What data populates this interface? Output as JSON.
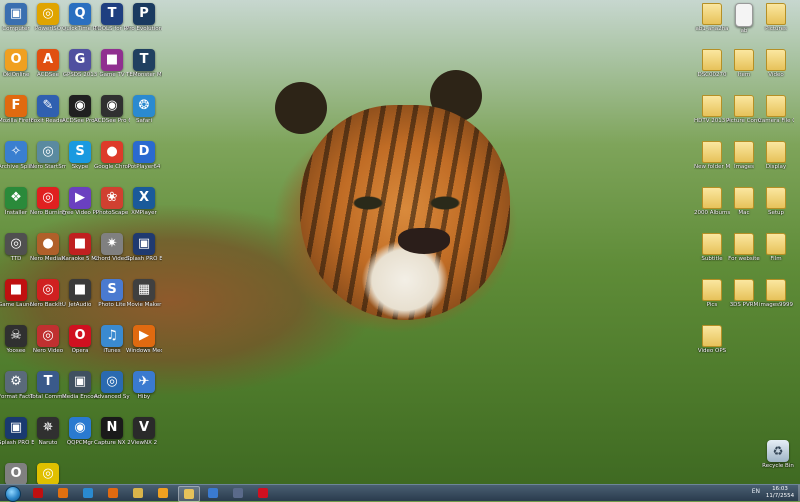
{
  "left_icons": [
    {
      "label": "Computer",
      "glyph": "▣",
      "color": "#3a6fb0",
      "icon": "computer-icon"
    },
    {
      "label": "PowerISO",
      "glyph": "◎",
      "color": "#e0a400",
      "icon": "disc-icon"
    },
    {
      "label": "QuickTime Player",
      "glyph": "Q",
      "color": "#2a6fc0",
      "icon": "quicktime-icon"
    },
    {
      "label": "TOOLS for PPSSPP",
      "glyph": "T",
      "color": "#1f3f80",
      "icon": "tools-icon"
    },
    {
      "label": "Pro Evolution Soccer 2013",
      "glyph": "P",
      "color": "#1a3a60",
      "icon": "game-icon"
    },
    {
      "label": "OkiOnline",
      "glyph": "O",
      "color": "#f0a020",
      "icon": "basketball-icon"
    },
    {
      "label": "ACDSee",
      "glyph": "A",
      "color": "#e05010",
      "icon": "acdsee-icon"
    },
    {
      "label": "GPSDS 2013",
      "glyph": "G",
      "color": "#5050a0",
      "icon": "gps-icon"
    },
    {
      "label": "Game TV",
      "glyph": "■",
      "color": "#903090",
      "icon": "tv-icon"
    },
    {
      "label": "TEMonster Media",
      "glyph": "T",
      "color": "#204060",
      "icon": "media-icon"
    },
    {
      "label": "Mozilla Firefox",
      "glyph": "F",
      "color": "#e06a10",
      "icon": "firefox-icon"
    },
    {
      "label": "Foxit Reader",
      "glyph": "✎",
      "color": "#3060b0",
      "icon": "foxit-icon"
    },
    {
      "label": "ACDSee Pro 6",
      "glyph": "◉",
      "color": "#202020",
      "icon": "camera-icon"
    },
    {
      "label": "ACDSee Pro 6",
      "glyph": "◉",
      "color": "#303030",
      "icon": "camera-icon"
    },
    {
      "label": "Safari",
      "glyph": "❂",
      "color": "#2a8ad0",
      "icon": "safari-icon"
    },
    {
      "label": "Archive Splitter",
      "glyph": "✧",
      "color": "#3a7fd0",
      "icon": "splitter-icon"
    },
    {
      "label": "Nero StartSmart",
      "glyph": "◎",
      "color": "#5a8aa0",
      "icon": "search-disc-icon"
    },
    {
      "label": "Skype",
      "glyph": "S",
      "color": "#1a9ae0",
      "icon": "skype-icon"
    },
    {
      "label": "Google Chrome",
      "glyph": "●",
      "color": "#dd3a2a",
      "icon": "chrome-icon"
    },
    {
      "label": "PotPlayer64",
      "glyph": "D",
      "color": "#2a6ad0",
      "icon": "player-icon"
    },
    {
      "label": "Installer",
      "glyph": "❖",
      "color": "#2a8a3a",
      "icon": "installer-icon"
    },
    {
      "label": "Nero Burning ROM",
      "glyph": "◎",
      "color": "#e02020",
      "icon": "nero-icon"
    },
    {
      "label": "Free Video Player",
      "glyph": "▶",
      "color": "#6a40c0",
      "icon": "video-player-icon"
    },
    {
      "label": "PhotoScape",
      "glyph": "❀",
      "color": "#d04030",
      "icon": "photoscape-icon"
    },
    {
      "label": "XMPlayer",
      "glyph": "X",
      "color": "#1a5a9a",
      "icon": "xmplayer-icon"
    },
    {
      "label": "TTD",
      "glyph": "◎",
      "color": "#505050",
      "icon": "wheel-icon"
    },
    {
      "label": "Nero MediaHome",
      "glyph": "●",
      "color": "#b0602a",
      "icon": "mediahome-icon"
    },
    {
      "label": "Karaoke 5 Movie Maker",
      "glyph": "■",
      "color": "#c02020",
      "icon": "karaoke-icon"
    },
    {
      "label": "Chord VideoStudio",
      "glyph": "✷",
      "color": "#808080",
      "icon": "videostudio-icon"
    },
    {
      "label": "Splash PRO EX",
      "glyph": "▣",
      "color": "#203a70",
      "icon": "splash-icon"
    },
    {
      "label": "Game Launcher",
      "glyph": "■",
      "color": "#c01010",
      "icon": "game-launcher-icon"
    },
    {
      "label": "Nero BackItUp",
      "glyph": "◎",
      "color": "#d02020",
      "icon": "backup-icon"
    },
    {
      "label": "JetAudio",
      "glyph": "■",
      "color": "#3a3a3a",
      "icon": "jetaudio-icon"
    },
    {
      "label": "Photo Lite",
      "glyph": "S",
      "color": "#4a7ad0",
      "icon": "photo-icon"
    },
    {
      "label": "Movie Maker",
      "glyph": "▦",
      "color": "#404040",
      "icon": "moviemaker-icon"
    },
    {
      "label": "Yoosee",
      "glyph": "☠",
      "color": "#303030",
      "icon": "yoosee-icon"
    },
    {
      "label": "Nero Video",
      "glyph": "◎",
      "color": "#c03030",
      "icon": "nero-video-icon"
    },
    {
      "label": "Opera",
      "glyph": "O",
      "color": "#d01020",
      "icon": "opera-icon"
    },
    {
      "label": "iTunes",
      "glyph": "♫",
      "color": "#3a8ad0",
      "icon": "itunes-icon"
    },
    {
      "label": "Windows Media Player",
      "glyph": "▶",
      "color": "#e06a10",
      "icon": "wmp-icon"
    },
    {
      "label": "Format Factory",
      "glyph": "⚙",
      "color": "#5a6a7a",
      "icon": "format-factory-icon"
    },
    {
      "label": "Total Commander",
      "glyph": "T",
      "color": "#3a5a8a",
      "icon": "commander-icon"
    },
    {
      "label": "Media Encoder",
      "glyph": "▣",
      "color": "#405060",
      "icon": "encoder-icon"
    },
    {
      "label": "Advanced SystemCare",
      "glyph": "◎",
      "color": "#2a6ab0",
      "icon": "systemcare-icon"
    },
    {
      "label": "Hiby",
      "glyph": "✈",
      "color": "#3a7ad0",
      "icon": "hiby-icon"
    },
    {
      "label": "Splash PRO EX",
      "glyph": "▣",
      "color": "#1a3a70",
      "icon": "splash-icon"
    },
    {
      "label": "Naruto",
      "glyph": "✵",
      "color": "#303030",
      "icon": "naruto-icon"
    },
    {
      "label": "QQPCMgr",
      "glyph": "◉",
      "color": "#2a7ad0",
      "icon": "qq-icon"
    },
    {
      "label": "Capture NX 2",
      "glyph": "N",
      "color": "#1a1a1a",
      "icon": "capture-nx-icon"
    },
    {
      "label": "ViewNX 2",
      "glyph": "V",
      "color": "#2a2a2a",
      "icon": "viewnx-icon"
    },
    {
      "label": "Opera Next",
      "glyph": "O",
      "color": "#808080",
      "icon": "opera-next-icon"
    },
    {
      "label": "Virtual Guitar",
      "glyph": "◎",
      "color": "#e0c000",
      "icon": "guitar-icon"
    }
  ],
  "right_icons": [
    {
      "label": "ab1-ana2ha",
      "type": "folder",
      "icon": "folder-icon"
    },
    {
      "label": "ab",
      "type": "file",
      "icon": "text-file-icon"
    },
    {
      "label": "Pictures",
      "type": "folder",
      "icon": "folder-icon"
    },
    {
      "label": "DSC00270",
      "type": "folder",
      "icon": "folder-icon"
    },
    {
      "label": "Item",
      "type": "folder",
      "icon": "folder-icon"
    },
    {
      "label": "Video",
      "type": "folder",
      "icon": "folder-icon"
    },
    {
      "label": "HDTV 2013 All Capture",
      "type": "folder",
      "icon": "folder-icon"
    },
    {
      "label": "Picture Control",
      "type": "folder",
      "icon": "folder-icon"
    },
    {
      "label": "Camera File Control Folder",
      "type": "folder",
      "icon": "folder-icon"
    },
    {
      "label": "New folder MAC 2013",
      "type": "folder",
      "icon": "folder-icon"
    },
    {
      "label": "Images",
      "type": "folder",
      "icon": "folder-icon"
    },
    {
      "label": "Display",
      "type": "folder",
      "icon": "folder-icon"
    },
    {
      "label": "2000 Albums",
      "type": "folder",
      "icon": "folder-icon"
    },
    {
      "label": "Mac",
      "type": "folder",
      "icon": "folder-icon"
    },
    {
      "label": "Setup",
      "type": "folder",
      "icon": "folder-icon"
    },
    {
      "label": "Subtitle",
      "type": "folder",
      "icon": "folder-icon"
    },
    {
      "label": "For website",
      "type": "folder",
      "icon": "folder-icon"
    },
    {
      "label": "Film",
      "type": "folder",
      "icon": "folder-icon"
    },
    {
      "label": "Pics",
      "type": "folder",
      "icon": "folder-icon"
    },
    {
      "label": "3DS PVRM",
      "type": "folder",
      "icon": "folder-icon"
    },
    {
      "label": "images9999",
      "type": "folder",
      "icon": "folder-icon"
    },
    {
      "label": "Video OPS",
      "type": "folder",
      "icon": "folder-icon"
    }
  ],
  "recycle_bin": {
    "label": "Recycle Bin",
    "icon": "recycle-bin-icon"
  },
  "taskbar": {
    "buttons": [
      {
        "name": "taskbar-game-button",
        "color": "#c01010",
        "icon": "game-icon",
        "active": false
      },
      {
        "name": "taskbar-media-player-button",
        "color": "#e07010",
        "icon": "media-player-icon",
        "active": false
      },
      {
        "name": "taskbar-ie-button",
        "color": "#2a8ad0",
        "icon": "ie-icon",
        "active": false
      },
      {
        "name": "taskbar-firefox-button",
        "color": "#e06a10",
        "icon": "firefox-icon",
        "active": false
      },
      {
        "name": "taskbar-explorer-button",
        "color": "#d9b44a",
        "icon": "folder-icon",
        "active": false
      },
      {
        "name": "taskbar-basketball-button",
        "color": "#f0a020",
        "icon": "basketball-icon",
        "active": false
      },
      {
        "name": "taskbar-folder-button",
        "color": "#e7c25a",
        "icon": "folder-icon",
        "active": true
      },
      {
        "name": "taskbar-network-button",
        "color": "#3a7ad0",
        "icon": "network-icon",
        "active": false
      },
      {
        "name": "taskbar-app-button",
        "color": "#5a6a8a",
        "icon": "app-icon",
        "active": false
      },
      {
        "name": "taskbar-opera-button",
        "color": "#d01020",
        "icon": "opera-icon",
        "active": false
      }
    ],
    "tray_lang": "EN",
    "time": "16:03",
    "date": "11/7/2554"
  }
}
